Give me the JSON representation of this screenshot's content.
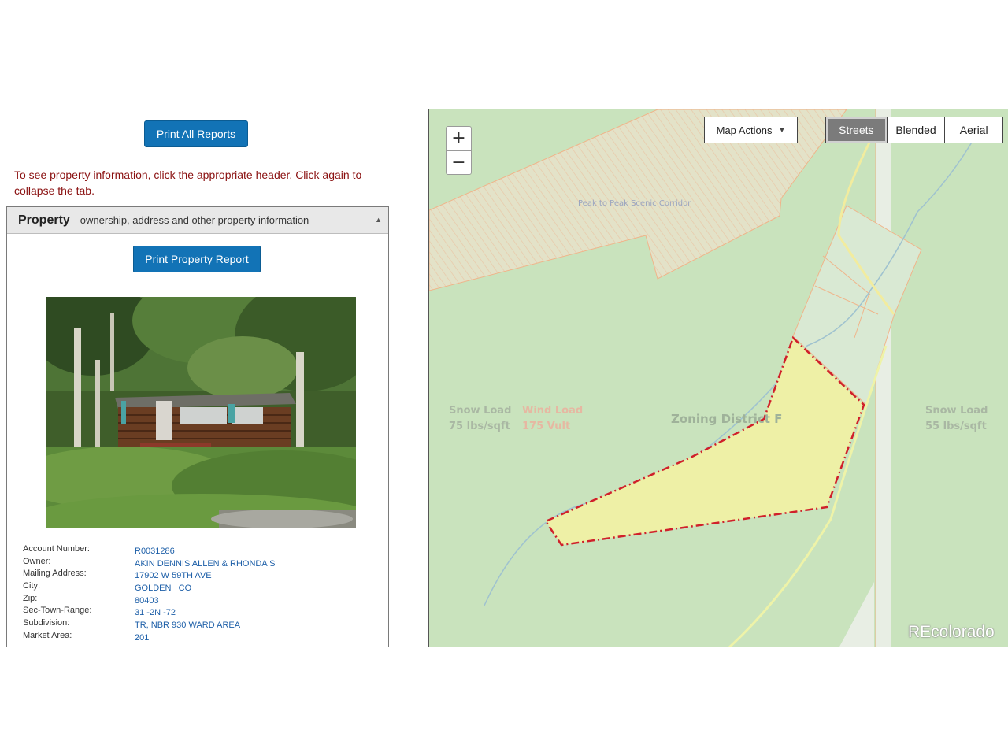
{
  "actions": {
    "print_all_label": "Print All Reports"
  },
  "instructions": "To see property information, click the appropriate header. Click again to collapse the tab.",
  "property_panel": {
    "title": "Property",
    "subtitle": "—ownership, address and other property information",
    "collapse_glyph": "▲",
    "print_label": "Print Property Report",
    "photo_description": "property-photo",
    "fields": [
      {
        "label": "Account Number:",
        "value": "R0031286"
      },
      {
        "label": "Owner:",
        "value": "AKIN DENNIS ALLEN & RHONDA S"
      },
      {
        "label": "Mailing Address:",
        "value": "17902 W 59TH AVE"
      },
      {
        "label": "City:",
        "value": "GOLDEN   CO"
      },
      {
        "label": "Zip:",
        "value": "80403"
      },
      {
        "label": "Sec-Town-Range:",
        "value": "31 -2N -72"
      },
      {
        "label": "Subdivision:",
        "value": "TR, NBR 930 WARD AREA"
      },
      {
        "label": "Market Area:",
        "value": "201"
      }
    ]
  },
  "map": {
    "zoom_in": "+",
    "zoom_out": "−",
    "map_actions_label": "Map Actions",
    "map_actions_caret": "▼",
    "layers": [
      "Streets",
      "Blended",
      "Aerial"
    ],
    "active_layer": "Streets",
    "corridor_label": "Peak to Peak Scenic Corridor",
    "snow_load_left": {
      "line1": "Snow Load",
      "line2": "75 lbs/sqft"
    },
    "wind_load": {
      "line1": "Wind Load",
      "line2": "175 Vult"
    },
    "zoning": "Zoning District F",
    "snow_load_right": {
      "line1": "Snow Load",
      "line2": "55 lbs/sqft"
    },
    "watermark": "REcolorado",
    "colors": {
      "background": "#c9e3bd",
      "parcel_fill": "#eef0a6",
      "parcel_outline": "#d0202a",
      "corridor": "#e3e2c8",
      "boundary": "#f0b48a"
    }
  }
}
